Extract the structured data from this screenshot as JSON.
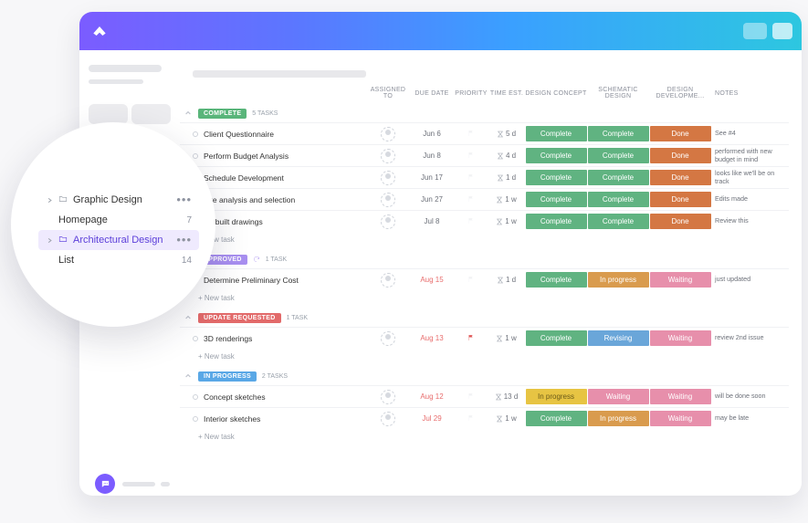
{
  "header_columns": [
    "ASSIGNED TO",
    "DUE DATE",
    "PRIORITY",
    "TIME EST.",
    "DESIGN CONCEPT",
    "SCHEMATIC DESIGN",
    "DESIGN DEVELOPME...",
    "NOTES"
  ],
  "status_colors": {
    "Complete": "s-green",
    "Done": "s-orange",
    "In progress": "s-amber",
    "Waiting": "s-pink",
    "Revising": "s-blue",
    "In progress_y": "s-yellow"
  },
  "add_task_label": "+ New task",
  "groups": [
    {
      "tag_label": "COMPLETE",
      "tag_class": "green",
      "count_label": "5 TASKS",
      "rows": [
        {
          "name": "Client Questionnaire",
          "due": "Jun 6",
          "est": "5 d",
          "c1": "Complete",
          "c2": "Complete",
          "c3": "Done",
          "notes": "See #4"
        },
        {
          "name": "Perform Budget Analysis",
          "due": "Jun 8",
          "est": "4 d",
          "c1": "Complete",
          "c2": "Complete",
          "c3": "Done",
          "notes": "performed with new budget in mind"
        },
        {
          "name": "Schedule Development",
          "due": "Jun 17",
          "est": "1 d",
          "c1": "Complete",
          "c2": "Complete",
          "c3": "Done",
          "notes": "looks like we'll be on track"
        },
        {
          "name": "Site analysis and selection",
          "due": "Jun 27",
          "est": "1 w",
          "c1": "Complete",
          "c2": "Complete",
          "c3": "Done",
          "notes": "Edits made"
        },
        {
          "name": "As-built drawings",
          "due": "Jul 8",
          "est": "1 w",
          "c1": "Complete",
          "c2": "Complete",
          "c3": "Done",
          "notes": "Review this"
        }
      ]
    },
    {
      "tag_label": "APPROVED",
      "tag_class": "purple",
      "has_refresh": true,
      "count_label": "1 TASK",
      "rows": [
        {
          "name": "Determine Preliminary Cost",
          "due": "Aug 15",
          "due_red": true,
          "est": "1 d",
          "c1": "Complete",
          "c2": "In progress",
          "c3": "Waiting",
          "notes": "just updated"
        }
      ]
    },
    {
      "tag_label": "UPDATE REQUESTED",
      "tag_class": "red",
      "count_label": "1 TASK",
      "rows": [
        {
          "name": "3D renderings",
          "due": "Aug 13",
          "due_red": true,
          "flag": true,
          "est": "1 w",
          "c1": "Complete",
          "c2": "Revising",
          "c3": "Waiting",
          "notes": "review 2nd issue"
        }
      ]
    },
    {
      "tag_label": "IN PROGRESS",
      "tag_class": "blue",
      "count_label": "2 TASKS",
      "rows": [
        {
          "name": "Concept sketches",
          "due": "Aug 12",
          "due_red": true,
          "est": "13 d",
          "c1": "In progress_y",
          "c2": "Waiting",
          "c3": "Waiting",
          "notes": "will be done soon"
        },
        {
          "name": "Interior sketches",
          "due": "Jul 29",
          "due_red": true,
          "est": "1 w",
          "c1": "Complete",
          "c2": "In progress",
          "c3": "Waiting",
          "notes": "may be late"
        }
      ]
    }
  ],
  "sidebar": {
    "items": [
      {
        "label": "Graphic Design",
        "folder": true,
        "expandable": true,
        "more": true
      },
      {
        "label": "Homepage",
        "count": "7",
        "child": true
      },
      {
        "label": "Architectural Design",
        "folder": true,
        "expandable": true,
        "active": true,
        "more": true
      },
      {
        "label": "List",
        "count": "14",
        "child": true
      }
    ]
  }
}
